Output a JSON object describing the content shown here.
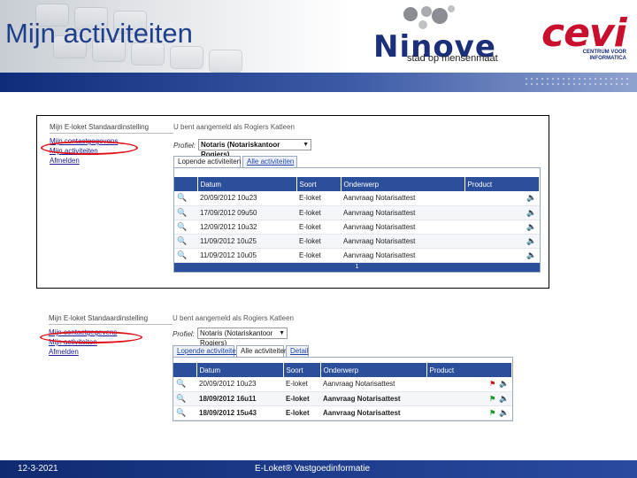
{
  "header": {
    "title": "Mijn activiteiten",
    "logo_ninove": "Ninove",
    "logo_ninove_tagline": "stad op mensenmaat",
    "logo_cevi": "cevi",
    "logo_cevi_tagline": "CENTRUM VOOR INFORMATICA"
  },
  "screenshot1": {
    "menu": {
      "title": "Mijn E-loket Standaardinstelling",
      "items": [
        "Mijn contactgegevens",
        "Mijn activiteiten",
        "Afmelden"
      ]
    },
    "logged_in": "U bent aangemeld als Rogiers Katleen",
    "profile_label": "Profiel:",
    "profile_value": "Notaris (Notariskantoor Rogiers)",
    "tabs": [
      "Lopende activiteiten",
      "Alle activiteiten"
    ],
    "columns": [
      "",
      "Datum",
      "Soort",
      "Onderwerp",
      "Product"
    ],
    "rows": [
      {
        "datum": "20/09/2012 10u23",
        "soort": "E-loket",
        "onderwerp": "Aanvraag Notarisattest"
      },
      {
        "datum": "17/09/2012 09u50",
        "soort": "E-loket",
        "onderwerp": "Aanvraag Notarisattest"
      },
      {
        "datum": "12/09/2012 10u32",
        "soort": "E-loket",
        "onderwerp": "Aanvraag Notarisattest"
      },
      {
        "datum": "11/09/2012 10u25",
        "soort": "E-loket",
        "onderwerp": "Aanvraag Notarisattest"
      },
      {
        "datum": "11/09/2012 10u05",
        "soort": "E-loket",
        "onderwerp": "Aanvraag Notarisattest"
      }
    ],
    "pager": "1"
  },
  "screenshot2": {
    "menu": {
      "title": "Mijn E-loket Standaardinstelling",
      "items": [
        "Mijn contactgegevens",
        "Mijn activiteiten",
        "Afmelden"
      ]
    },
    "logged_in": "U bent aangemeld als Rogiers Katleen",
    "profile_label": "Profiel:",
    "profile_value": "Notaris (Notariskantoor Rogiers)",
    "tabs": [
      "Lopende activiteiten",
      "Alle activiteiten",
      "Detail"
    ],
    "columns": [
      "",
      "Datum",
      "Soort",
      "Onderwerp",
      "Product"
    ],
    "rows": [
      {
        "datum": "20/09/2012 10u23",
        "soort": "E-loket",
        "onderwerp": "Aanvraag Notarisattest"
      },
      {
        "datum": "18/09/2012 16u11",
        "soort": "E-loket",
        "onderwerp": "Aanvraag Notarisattest"
      },
      {
        "datum": "18/09/2012 15u43",
        "soort": "E-loket",
        "onderwerp": "Aanvraag Notarisattest"
      }
    ]
  },
  "footer": {
    "date": "12-3-2021",
    "text": "E-Loket® Vastgoedinformatie"
  },
  "colors": {
    "title": "#1f3f8c",
    "table_header": "#2b4f9a",
    "highlight_ellipse": "#e0101a",
    "footer_bar": "#1e3c8c"
  }
}
